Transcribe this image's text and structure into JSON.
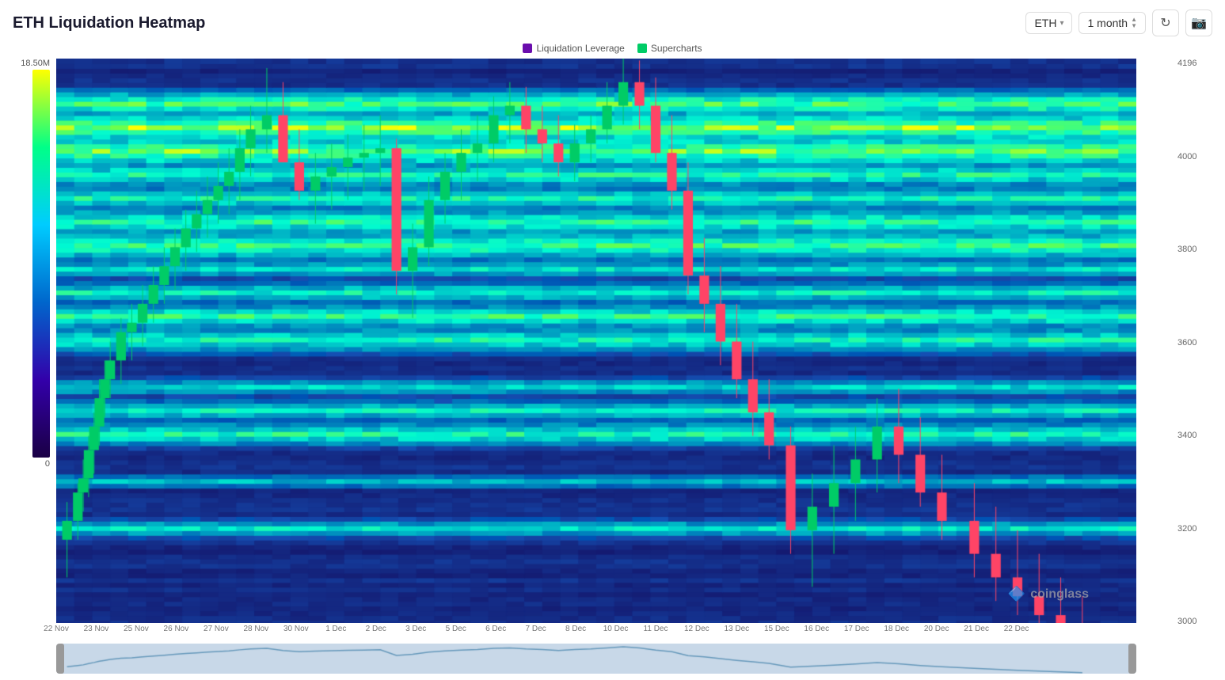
{
  "header": {
    "title": "ETH Liquidation Heatmap",
    "asset_label": "ETH",
    "asset_arrow": "▾",
    "timeframe": "1 month",
    "refresh_icon": "↻",
    "screenshot_icon": "📷"
  },
  "legend": {
    "items": [
      {
        "label": "Liquidation Leverage",
        "color": "#6a0dad"
      },
      {
        "label": "Supercharts",
        "color": "#00cc66"
      }
    ]
  },
  "color_scale": {
    "top_label": "18.50M",
    "bottom_label": "0"
  },
  "y_axis": {
    "labels": [
      "4196",
      "4000",
      "3800",
      "3600",
      "3400",
      "3200",
      "3000"
    ]
  },
  "x_axis": {
    "labels": [
      {
        "text": "22 Nov",
        "pct": 0
      },
      {
        "text": "23 Nov",
        "pct": 3.7
      },
      {
        "text": "25 Nov",
        "pct": 7.4
      },
      {
        "text": "26 Nov",
        "pct": 11.1
      },
      {
        "text": "27 Nov",
        "pct": 14.8
      },
      {
        "text": "28 Nov",
        "pct": 18.5
      },
      {
        "text": "30 Nov",
        "pct": 22.2
      },
      {
        "text": "1 Dec",
        "pct": 25.9
      },
      {
        "text": "2 Dec",
        "pct": 29.6
      },
      {
        "text": "3 Dec",
        "pct": 33.3
      },
      {
        "text": "5 Dec",
        "pct": 37.0
      },
      {
        "text": "6 Dec",
        "pct": 40.7
      },
      {
        "text": "7 Dec",
        "pct": 44.4
      },
      {
        "text": "8 Dec",
        "pct": 48.1
      },
      {
        "text": "10 Dec",
        "pct": 51.8
      },
      {
        "text": "11 Dec",
        "pct": 55.5
      },
      {
        "text": "12 Dec",
        "pct": 59.3
      },
      {
        "text": "13 Dec",
        "pct": 63.0
      },
      {
        "text": "15 Dec",
        "pct": 66.7
      },
      {
        "text": "16 Dec",
        "pct": 70.4
      },
      {
        "text": "17 Dec",
        "pct": 74.1
      },
      {
        "text": "18 Dec",
        "pct": 77.8
      },
      {
        "text": "20 Dec",
        "pct": 81.5
      },
      {
        "text": "21 Dec",
        "pct": 85.2
      },
      {
        "text": "22 Dec",
        "pct": 88.9
      }
    ]
  },
  "watermark": {
    "text": "coinglass"
  }
}
